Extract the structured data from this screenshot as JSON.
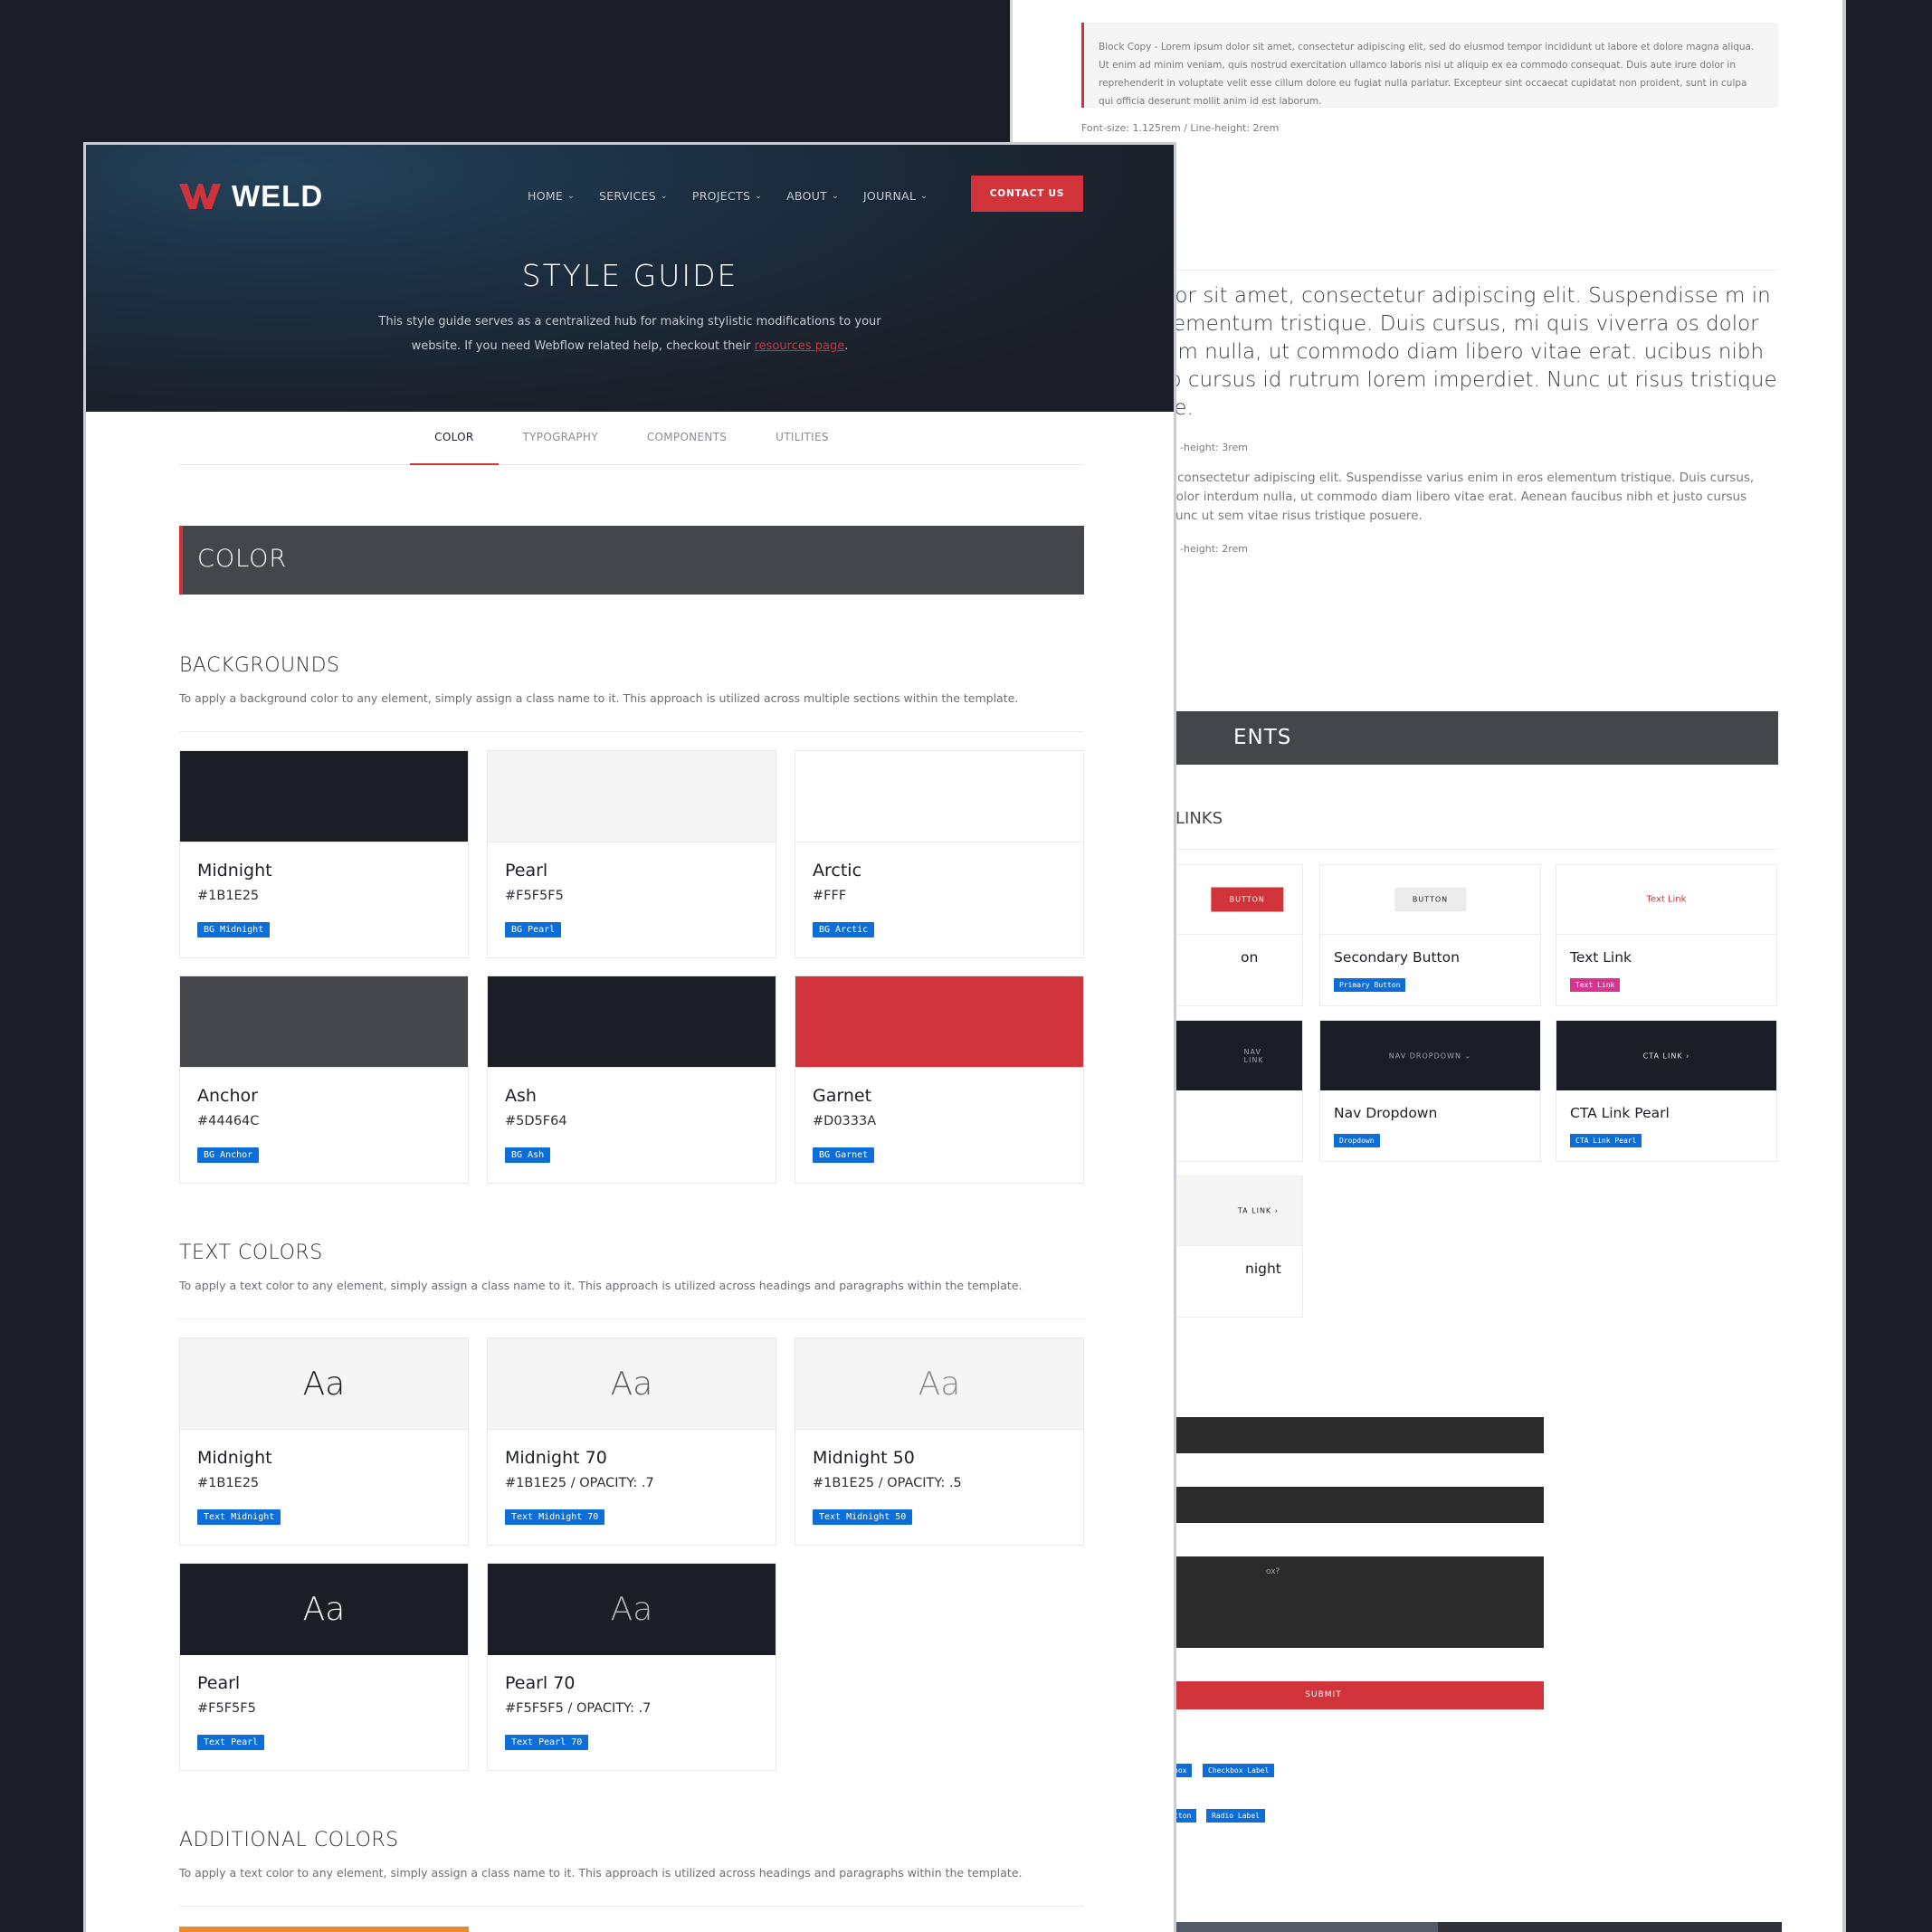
{
  "back": {
    "blockquote": "Block Copy - Lorem ipsum dolor sit amet, consectetur adipiscing elit, sed do eiusmod tempor incididunt ut labore et dolore magna aliqua. Ut enim ad minim veniam, quis nostrud exercitation ullamco laboris nisi ut aliquip ex ea commodo consequat. Duis aute irure dolor in reprehenderit in voluptate velit esse cillum dolore eu fugiat nulla pariatur. Excepteur sint occaecat cupidatat non proident, sunt in culpa qui officia deserunt mollit anim id est laborum.",
    "blockquote_meta": "Font-size: 1.125rem / Line-height: 2rem",
    "lead": "um dolor sit amet, consectetur adipiscing elit. Suspendisse m in eros elementum tristique. Duis cursus, mi quis viverra os dolor interdum nulla, ut commodo diam libero vitae erat. ucibus nibh et justo cursus id rutrum lorem imperdiet. Nunc ut risus tristique posuere.",
    "lead_meta": "-height: 3rem",
    "body": "or sit amet, consectetur adipiscing elit. Suspendisse varius enim in eros elementum tristique. Duis cursus, nare, eros dolor interdum nulla, ut commodo diam libero vitae erat. Aenean faucibus nibh et justo cursus mperdiet. Nunc ut sem vitae risus tristique posuere.",
    "body_meta": "-height: 2rem",
    "components_band": "ENTS",
    "links_heading": "LINKS",
    "cards": [
      {
        "preview": "BUTTON",
        "name": "on",
        "tag": ""
      },
      {
        "preview": "BUTTON",
        "name": "Secondary Button",
        "tag": "Primary Button"
      },
      {
        "preview": "Text Link",
        "name": "Text Link",
        "tag": "Text Link"
      },
      {
        "preview": "NAV LINK",
        "name": "",
        "tag": ""
      },
      {
        "preview": "NAV DROPDOWN ⌄",
        "name": "Nav Dropdown",
        "tag": "Dropdown"
      },
      {
        "preview": "CTA LINK ›",
        "name": "CTA Link Pearl",
        "tag": "CTA Link Pearl"
      },
      {
        "preview": "TA LINK ›",
        "name": "night",
        "tag": ""
      }
    ],
    "textarea_placeholder": "ox?",
    "submit": "SUBMIT",
    "chips": [
      "box",
      "Checkbox Label",
      "tton",
      "Radio Label"
    ]
  },
  "header": {
    "logo": "WELD",
    "nav": [
      "HOME",
      "SERVICES",
      "PROJECTS",
      "ABOUT",
      "JOURNAL"
    ],
    "contact": "CONTACT US",
    "title": "STYLE GUIDE",
    "desc_before": "This style guide serves as a centralized hub for making stylistic modifications to your website. If you need Webflow related help, checkout their ",
    "desc_link": "resources page",
    "desc_after": "."
  },
  "tabs": [
    "COLOR",
    "TYPOGRAPHY",
    "COMPONENTS",
    "UTILITIES"
  ],
  "color_band": "COLOR",
  "backgrounds": {
    "title": "BACKGROUNDS",
    "desc": "To apply a background color to any element, simply assign a class name to it. This approach is utilized across multiple sections within the template.",
    "items": [
      {
        "name": "Midnight",
        "hex": "#1B1E25",
        "tag": "BG Midnight",
        "color": "#1b1e25"
      },
      {
        "name": "Pearl",
        "hex": "#F5F5F5",
        "tag": "BG Pearl",
        "color": "#f5f5f5"
      },
      {
        "name": "Arctic",
        "hex": "#FFF",
        "tag": "BG Arctic",
        "color": "#ffffff"
      },
      {
        "name": "Anchor",
        "hex": "#44464C",
        "tag": "BG Anchor",
        "color": "#44464c"
      },
      {
        "name": "Ash",
        "hex": "#5D5F64",
        "tag": "BG Ash",
        "color": "#1b1e25"
      },
      {
        "name": "Garnet",
        "hex": "#D0333A",
        "tag": "BG Garnet",
        "color": "#d0333a"
      }
    ]
  },
  "text_colors": {
    "title": "TEXT COLORS",
    "desc": "To apply a text color to any element, simply assign a class name to it. This approach is utilized across headings and paragraphs within the template.",
    "sample": "Aa",
    "items": [
      {
        "name": "Midnight",
        "hex": "#1B1E25",
        "tag": "Text Midnight"
      },
      {
        "name": "Midnight 70",
        "hex": "#1B1E25 / OPACITY: .7",
        "tag": "Text Midnight 70"
      },
      {
        "name": "Midnight 50",
        "hex": "#1B1E25 / OPACITY: .5",
        "tag": "Text Midnight 50"
      },
      {
        "name": "Pearl",
        "hex": "#F5F5F5",
        "tag": "Text Pearl"
      },
      {
        "name": "Pearl 70",
        "hex": "#F5F5F5 / OPACITY: .7",
        "tag": "Text Pearl 70"
      }
    ]
  },
  "additional": {
    "title": "ADDITIONAL COLORS",
    "desc": "To apply a text color to any element, simply assign a class name to it. This approach is utilized across headings and paragraphs within the template."
  }
}
